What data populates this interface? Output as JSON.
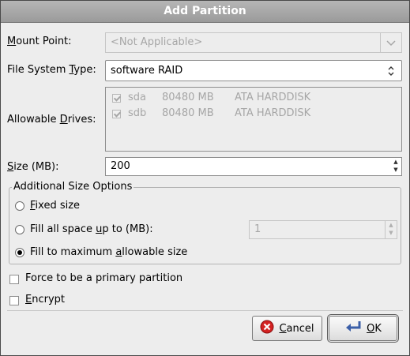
{
  "dialog": {
    "title": "Add Partition"
  },
  "mount_point": {
    "label_pre": "",
    "label_u": "M",
    "label_post": "ount Point:",
    "value": "<Not Applicable>",
    "disabled": true
  },
  "fs_type": {
    "label_pre": "File System ",
    "label_u": "T",
    "label_post": "ype:",
    "value": "software RAID"
  },
  "drives": {
    "label_pre": "Allowable ",
    "label_u": "D",
    "label_post": "rives:",
    "items": [
      {
        "name": "sda",
        "size": "80480 MB",
        "model": "ATA HARDDISK",
        "checked": true
      },
      {
        "name": "sdb",
        "size": "80480 MB",
        "model": "ATA HARDDISK",
        "checked": true
      }
    ]
  },
  "size": {
    "label_pre": "",
    "label_u": "S",
    "label_post": "ize (MB):",
    "value": "200"
  },
  "size_options": {
    "title": "Additional Size Options",
    "fixed": {
      "label_pre": "",
      "label_u": "F",
      "label_post": "ixed size",
      "selected": false
    },
    "fill_upto": {
      "label_pre": "Fill all space ",
      "label_u": "u",
      "label_post": "p to (MB):",
      "selected": false,
      "value": "1"
    },
    "fill_max": {
      "label_pre": "Fill to maximum ",
      "label_u": "a",
      "label_post": "llowable size",
      "selected": true
    }
  },
  "primary": {
    "label": "Force to be a primary partition",
    "checked": false
  },
  "encrypt": {
    "label_pre": "",
    "label_u": "E",
    "label_post": "ncrypt",
    "checked": false
  },
  "buttons": {
    "cancel_pre": "",
    "cancel_u": "C",
    "cancel_post": "ancel",
    "ok_pre": "",
    "ok_u": "O",
    "ok_post": "K"
  },
  "icons": {
    "cancel": "cancel-icon",
    "ok": "ok-enter-icon",
    "combo_arrow": "chevron-down-icon",
    "combo_updown": "up-down-arrows-icon"
  },
  "colors": {
    "title_bar": "#a8a8a8",
    "cancel_icon": "#d32222",
    "ok_icon": "#3b5fa8"
  }
}
